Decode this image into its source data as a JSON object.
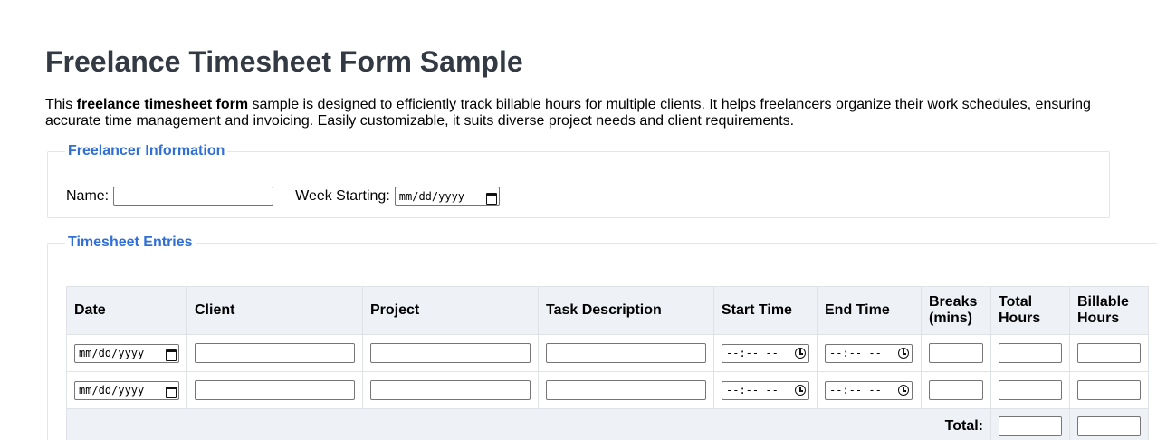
{
  "page": {
    "title": "Freelance Timesheet Form Sample",
    "intro_prefix": "This ",
    "intro_bold": "freelance timesheet form",
    "intro_suffix": " sample is designed to efficiently track billable hours for multiple clients. It helps freelancers organize their work schedules, ensuring accurate time management and invoicing. Easily customizable, it suits diverse project needs and client requirements."
  },
  "freelancer_info": {
    "legend": "Freelancer Information",
    "name_label": "Name:",
    "name_value": "",
    "week_label": "Week Starting:",
    "week_placeholder": "mm/dd/yyyy"
  },
  "timesheet": {
    "legend": "Timesheet Entries",
    "headers": [
      "Date",
      "Client",
      "Project",
      "Task Description",
      "Start Time",
      "End Time",
      "Breaks (mins)",
      "Total Hours",
      "Billable Hours"
    ],
    "rows": [
      {
        "date": "mm/dd/yyyy",
        "client": "",
        "project": "",
        "task": "",
        "start": "--:-- --",
        "end": "--:-- --",
        "breaks": "",
        "total": "",
        "billable": ""
      },
      {
        "date": "mm/dd/yyyy",
        "client": "",
        "project": "",
        "task": "",
        "start": "--:-- --",
        "end": "--:-- --",
        "breaks": "",
        "total": "",
        "billable": ""
      }
    ],
    "total_label": "Total:",
    "total_hours": "",
    "total_billable": ""
  },
  "icons": {
    "calendar": "calendar-icon",
    "clock": "clock-icon"
  },
  "colors": {
    "legend": "#2f6fd6",
    "title": "#333a44",
    "header_bg": "#eef2f7"
  }
}
